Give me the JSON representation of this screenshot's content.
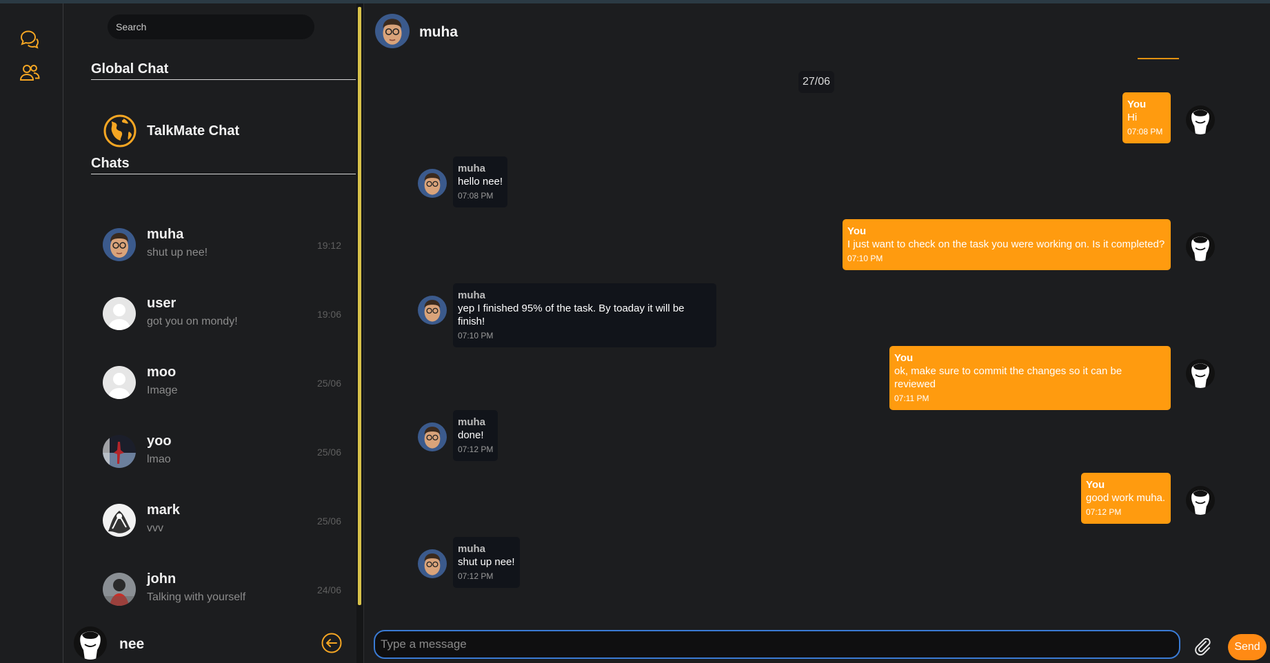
{
  "search": {
    "placeholder": "Search"
  },
  "sidebar": {
    "global_title": "Global Chat",
    "global_chat_name": "TalkMate Chat",
    "chats_title": "Chats",
    "chats": [
      {
        "name": "muha",
        "last": "shut up nee!",
        "time": "19:12",
        "avatar": "muha"
      },
      {
        "name": "user",
        "last": "got you on mondy!",
        "time": "19:06",
        "avatar": "placeholder"
      },
      {
        "name": "moo",
        "last": "Image",
        "time": "25/06",
        "avatar": "placeholder"
      },
      {
        "name": "yoo",
        "last": "lmao",
        "time": "25/06",
        "avatar": "dark-photo"
      },
      {
        "name": "mark",
        "last": "vvv",
        "time": "25/06",
        "avatar": "bw-art"
      },
      {
        "name": "john",
        "last": "Talking with yourself",
        "time": "24/06",
        "avatar": "red-photo"
      }
    ],
    "me": {
      "name": "nee"
    }
  },
  "conversation": {
    "title": "muha",
    "date_chip": "27/06",
    "messages": [
      {
        "dir": "out",
        "sender": "You",
        "text": "Hi",
        "time": "07:08 PM"
      },
      {
        "dir": "in",
        "sender": "muha",
        "text": "hello nee!",
        "time": "07:08 PM"
      },
      {
        "dir": "out",
        "sender": "You",
        "text": "I just want to check on the task you were working on. Is it completed?",
        "time": "07:10 PM"
      },
      {
        "dir": "in",
        "sender": "muha",
        "text": "yep I finished 95% of the task. By toaday it will be finish!",
        "time": "07:10 PM"
      },
      {
        "dir": "out",
        "sender": "You",
        "text": "ok, make sure to commit the changes so it can be reviewed",
        "time": "07:11 PM"
      },
      {
        "dir": "in",
        "sender": "muha",
        "text": "done!",
        "time": "07:12 PM"
      },
      {
        "dir": "out",
        "sender": "You",
        "text": "good work muha.",
        "time": "07:12 PM"
      },
      {
        "dir": "in",
        "sender": "muha",
        "text": "shut up nee!",
        "time": "07:12 PM"
      }
    ]
  },
  "composer": {
    "placeholder": "Type a message",
    "send_label": "Send"
  },
  "colors": {
    "accent": "#ff9b0f",
    "accent_dark": "#e39211",
    "bg": "#1c1d1f",
    "incoming_bubble": "#11141a",
    "focus_ring": "#3a7bd5"
  }
}
